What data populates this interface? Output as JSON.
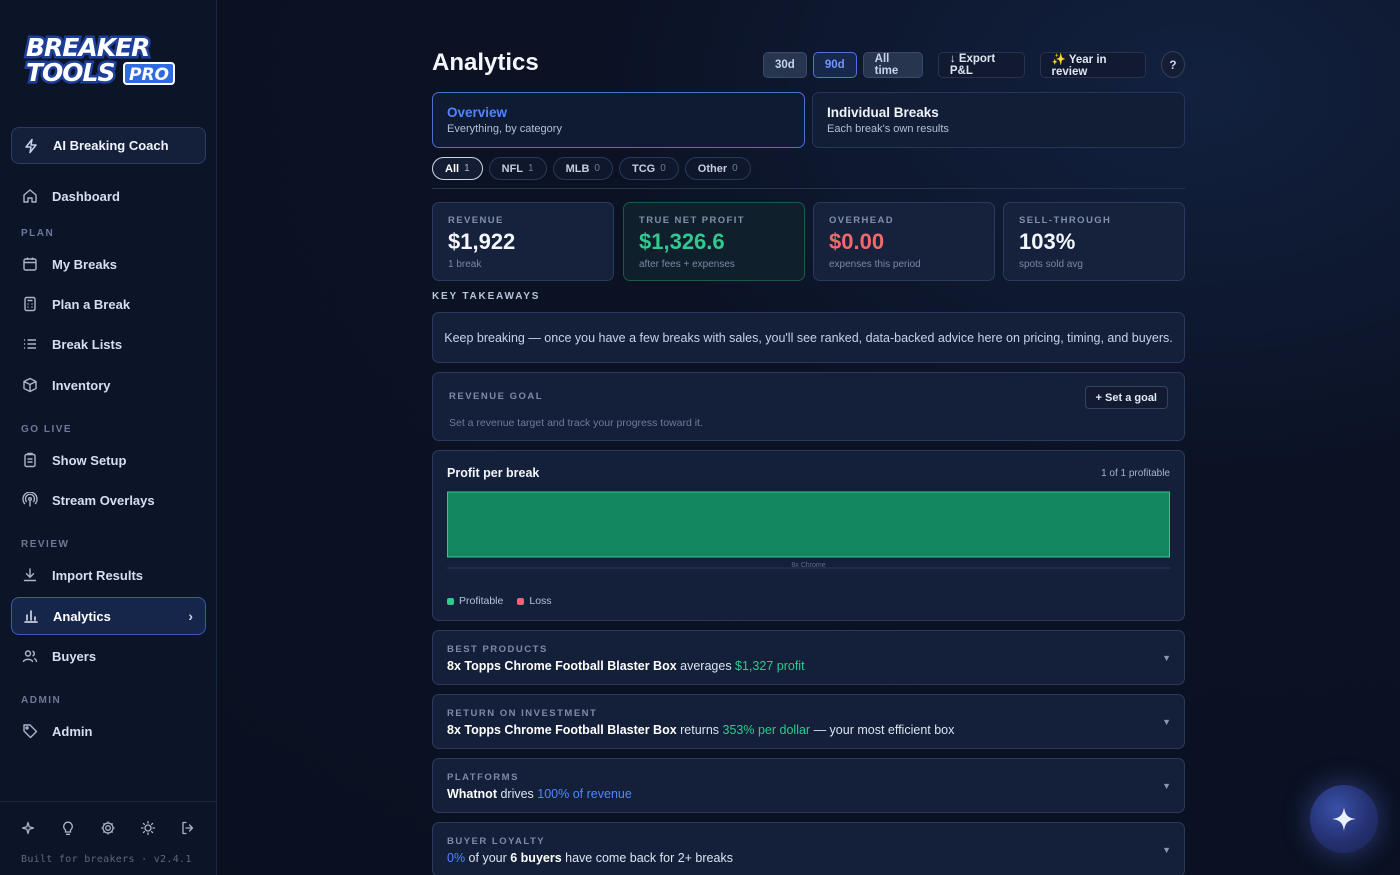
{
  "brand": {
    "logo_line1": "BREAKER",
    "logo_line2": "TOOLS",
    "logo_badge": "PRO"
  },
  "sidebar": {
    "coach_label": "AI Breaking Coach",
    "dashboard_label": "Dashboard",
    "sections": {
      "plan": "PLAN",
      "go_live": "GO LIVE",
      "review": "REVIEW",
      "admin": "ADMIN"
    },
    "items": {
      "my_breaks": "My Breaks",
      "plan_a_break": "Plan a Break",
      "break_lists": "Break Lists",
      "inventory": "Inventory",
      "show_setup": "Show Setup",
      "stream_overlays": "Stream Overlays",
      "import_results": "Import Results",
      "analytics": "Analytics",
      "buyers": "Buyers",
      "admin": "Admin"
    },
    "footer_version": "Built for breakers · v2.4.1"
  },
  "header": {
    "title": "Analytics",
    "range_30d": "30d",
    "range_90d": "90d",
    "range_all": "All time",
    "export_label": "↓ Export P&L",
    "year_review_label": "✨ Year in review",
    "help_label": "?"
  },
  "view_tabs": {
    "overview_title": "Overview",
    "overview_sub": "Everything, by category",
    "individual_title": "Individual Breaks",
    "individual_sub": "Each break's own results"
  },
  "filters": [
    {
      "label": "All",
      "count": "1"
    },
    {
      "label": "NFL",
      "count": "1"
    },
    {
      "label": "MLB",
      "count": "0"
    },
    {
      "label": "TCG",
      "count": "0"
    },
    {
      "label": "Other",
      "count": "0"
    }
  ],
  "kpis": {
    "revenue": {
      "label": "REVENUE",
      "value": "$1,922",
      "sub": "1 break"
    },
    "net_profit": {
      "label": "TRUE NET PROFIT",
      "value": "$1,326.6",
      "sub": "after fees + expenses"
    },
    "overhead": {
      "label": "OVERHEAD",
      "value": "$0.00",
      "sub": "expenses this period"
    },
    "sell_through": {
      "label": "SELL-THROUGH",
      "value": "103%",
      "sub": "spots sold avg"
    }
  },
  "key_takeaways": {
    "title": "KEY TAKEAWAYS",
    "message": "Keep breaking — once you have a few breaks with sales, you'll see ranked, data-backed advice here on pricing, timing, and buyers."
  },
  "revenue_goal": {
    "label": "REVENUE GOAL",
    "description": "Set a revenue target and track your progress toward it.",
    "button": "+ Set a goal"
  },
  "profit_chart": {
    "title": "Profit per break",
    "meta": "1 of 1 profitable",
    "legend_profitable": "Profitable",
    "legend_loss": "Loss"
  },
  "chart_data": {
    "type": "bar",
    "title": "Profit per break",
    "categories": [
      "8x Chrome"
    ],
    "values": [
      1326.6
    ],
    "series": [
      {
        "name": "Profitable",
        "values": [
          1326.6
        ]
      }
    ],
    "legend": [
      "Profitable",
      "Loss"
    ],
    "colors": {
      "profitable": "#13875f",
      "loss": "#f0647a"
    }
  },
  "insights": {
    "best_products": {
      "label": "BEST PRODUCTS",
      "subject": "8x Topps Chrome Football Blaster Box",
      "middle": " averages ",
      "highlight": "$1,327 profit"
    },
    "roi": {
      "label": "RETURN ON INVESTMENT",
      "subject": "8x Topps Chrome Football Blaster Box",
      "middle": " returns ",
      "highlight": "353% per dollar",
      "tail": " — your most efficient box"
    },
    "platforms": {
      "label": "PLATFORMS",
      "subject": "Whatnot",
      "middle": " drives ",
      "highlight": "100% of revenue"
    },
    "buyer_loyalty": {
      "label": "BUYER LOYALTY",
      "highlight": "0%",
      "middle": " of your ",
      "subject": "6 buyers",
      "tail": " have come back for 2+ breaks"
    }
  },
  "colors": {
    "accent": "#4f86ff",
    "positive": "#31c98f",
    "negative": "#f06a6a",
    "background": "#0b1224"
  }
}
